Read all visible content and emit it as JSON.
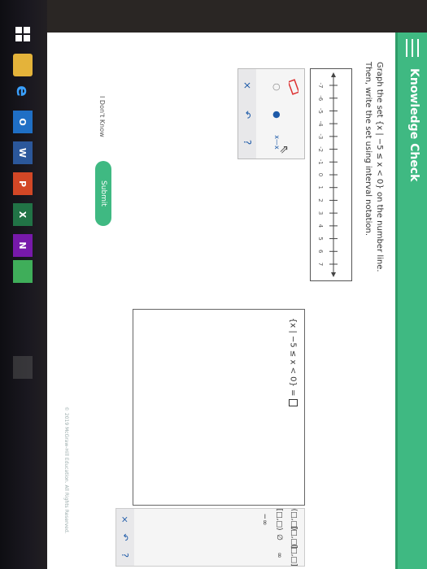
{
  "header": {
    "title": "Knowledge Check"
  },
  "question": {
    "line1": "Graph the set {x | −5 ≤ x < 0} on the number line.",
    "line2": "Then, write the set using interval notation."
  },
  "number_line": {
    "ticks": [
      "-7",
      "-6",
      "-5",
      "-4",
      "-3",
      "-2",
      "-1",
      "0",
      "1",
      "2",
      "3",
      "4",
      "5",
      "6",
      "7"
    ]
  },
  "tools": {
    "open_point": "○",
    "closed_point": "●",
    "segment": "x—x",
    "clear": "×",
    "undo": "↶",
    "help": "?"
  },
  "answer": {
    "expression": "{x | −5 ≤ x < 0} ="
  },
  "pad": {
    "row1": [
      "(□,□)",
      "[□,□]",
      "(□,□]"
    ],
    "row2": [
      "[□,□)",
      "∅",
      "∞"
    ],
    "row3": [
      "−∞"
    ],
    "clear": "×",
    "undo": "↶",
    "help": "?"
  },
  "actions": {
    "dont_know": "I Don't Know",
    "submit": "Submit"
  },
  "footer": {
    "text": "© 2019 McGraw-Hill Education. All Rights Reserved."
  },
  "taskbar": {
    "items": [
      "",
      "",
      "e",
      "O",
      "W",
      "P",
      "X",
      "N",
      ""
    ]
  },
  "colors": {
    "accent": "#3fb982",
    "link": "#1d5aa8"
  }
}
